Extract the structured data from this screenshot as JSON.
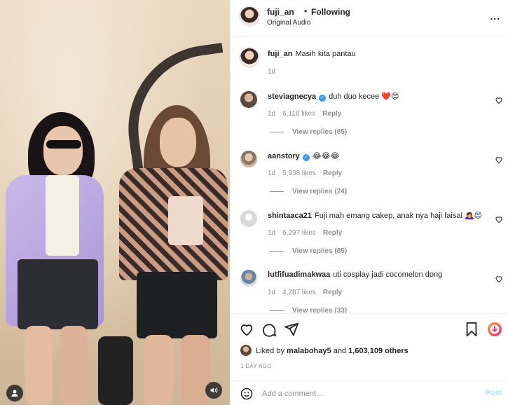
{
  "header": {
    "username": "fuji_an",
    "dot": "•",
    "follow_label": "Following",
    "audio": "Original Audio",
    "more": "..."
  },
  "caption": {
    "username": "fuji_an",
    "text": "Masih kita pantau",
    "time": "1d"
  },
  "comments": [
    {
      "username": "steviagnecya",
      "verified": true,
      "text": "duh duo kecee ❤️😍",
      "time": "1d",
      "likes": "6,118 likes",
      "reply_label": "Reply",
      "replies": "View replies (85)"
    },
    {
      "username": "aanstory",
      "verified": true,
      "text": "😂😂😂",
      "time": "1d",
      "likes": "5,938 likes",
      "reply_label": "Reply",
      "replies": "View replies (24)"
    },
    {
      "username": "shintaaca21",
      "verified": false,
      "text": "Fuji mah emang cakep, anak nya haji faisal 🙇‍♀️😍",
      "time": "1d",
      "likes": "6,297 likes",
      "reply_label": "Reply",
      "replies": "View replies (85)"
    },
    {
      "username": "lutfifuadimakwaa",
      "verified": false,
      "text": "uti cosplay jadi cocomelon dong",
      "time": "1d",
      "likes": "4,287 likes",
      "reply_label": "Reply",
      "replies": "View replies (33)"
    }
  ],
  "likes": {
    "prefix": "Liked by",
    "user": "malabohay5",
    "and": "and",
    "others": "1,603,109 others"
  },
  "time_ago": "1 DAY AGO",
  "add_comment": {
    "placeholder": "Add a comment...",
    "post_label": "Post"
  },
  "icons": {
    "heart": "heart-icon",
    "comment": "comment-icon",
    "share": "share-icon",
    "save": "bookmark-icon",
    "emoji": "emoji-icon",
    "user": "user-icon",
    "sound": "speaker-icon",
    "more": "more-icon"
  },
  "colors": {
    "verified": "#3897f0",
    "post_disabled": "#b2dffc",
    "secondary_text": "#8e8e8e"
  }
}
